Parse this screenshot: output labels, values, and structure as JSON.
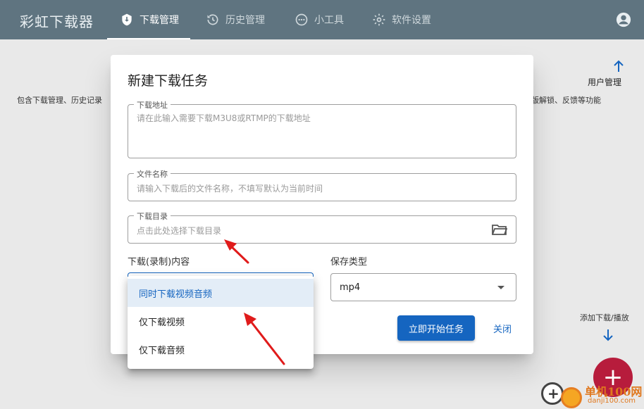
{
  "app": {
    "title": "彩虹下载器"
  },
  "nav": {
    "tabs": [
      {
        "label": "下载管理",
        "icon": "download-shield-icon",
        "active": true
      },
      {
        "label": "历史管理",
        "icon": "history-icon",
        "active": false
      },
      {
        "label": "小工具",
        "icon": "tools-icon",
        "active": false
      },
      {
        "label": "软件设置",
        "icon": "gear-icon",
        "active": false
      }
    ],
    "account_icon": "account-circle-icon"
  },
  "background": {
    "desc_left": "包含下载管理、历史记录",
    "desc_right": "完整版解锁、反馈等功能",
    "user_mgmt": "用户管理",
    "add_download": "添加下载/播放",
    "fab_label": "+"
  },
  "dialog": {
    "title": "新建下载任务",
    "url_field": {
      "label": "下载地址",
      "placeholder": "请在此输入需要下载M3U8或RTMP的下载地址"
    },
    "filename_field": {
      "label": "文件名称",
      "placeholder": "请输入下载后的文件名称，不填写默认为当前时间"
    },
    "directory_field": {
      "label": "下载目录",
      "placeholder": "点击此处选择下载目录"
    },
    "content_label": "下载(录制)内容",
    "save_type_label": "保存类型",
    "save_type_value": "mp4",
    "start_button": "立即开始任务",
    "close_button": "关闭"
  },
  "content_menu": {
    "options": [
      "同时下载视频音频",
      "仅下载视频",
      "仅下载音频"
    ],
    "selected_index": 0
  },
  "watermark": {
    "text_main": "单机100网",
    "text_sub": "danji100.com"
  },
  "colors": {
    "appbar": "#5f7480",
    "primary": "#1565c0",
    "fab": "#b71c3c",
    "annotation": "#e01b1b"
  }
}
